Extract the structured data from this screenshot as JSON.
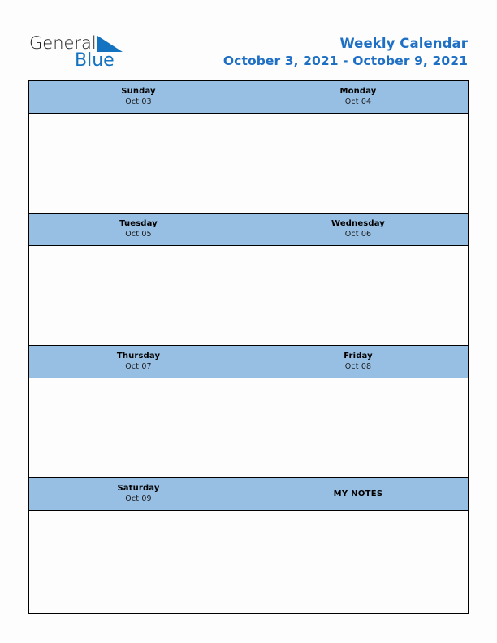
{
  "brand": {
    "name_part1": "General",
    "name_part2": "Blue",
    "logo_icon": "blue-triangle-icon",
    "accent_color": "#1473c0"
  },
  "header": {
    "title": "Weekly Calendar",
    "date_range": "October 3, 2021 - October 9, 2021",
    "title_color": "#1f70c4"
  },
  "calendar": {
    "header_background": "#97bfe3",
    "body_background": "#fdfdfd",
    "border_color": "#000000",
    "sections": [
      {
        "left": {
          "type": "day",
          "name": "Sunday",
          "date": "Oct 03",
          "entry": ""
        },
        "right": {
          "type": "day",
          "name": "Monday",
          "date": "Oct 04",
          "entry": ""
        }
      },
      {
        "left": {
          "type": "day",
          "name": "Tuesday",
          "date": "Oct 05",
          "entry": ""
        },
        "right": {
          "type": "day",
          "name": "Wednesday",
          "date": "Oct 06",
          "entry": ""
        }
      },
      {
        "left": {
          "type": "day",
          "name": "Thursday",
          "date": "Oct 07",
          "entry": ""
        },
        "right": {
          "type": "day",
          "name": "Friday",
          "date": "Oct 08",
          "entry": ""
        }
      },
      {
        "left": {
          "type": "day",
          "name": "Saturday",
          "date": "Oct 09",
          "entry": ""
        },
        "right": {
          "type": "notes",
          "name": "MY NOTES",
          "date": "",
          "entry": ""
        }
      }
    ]
  }
}
